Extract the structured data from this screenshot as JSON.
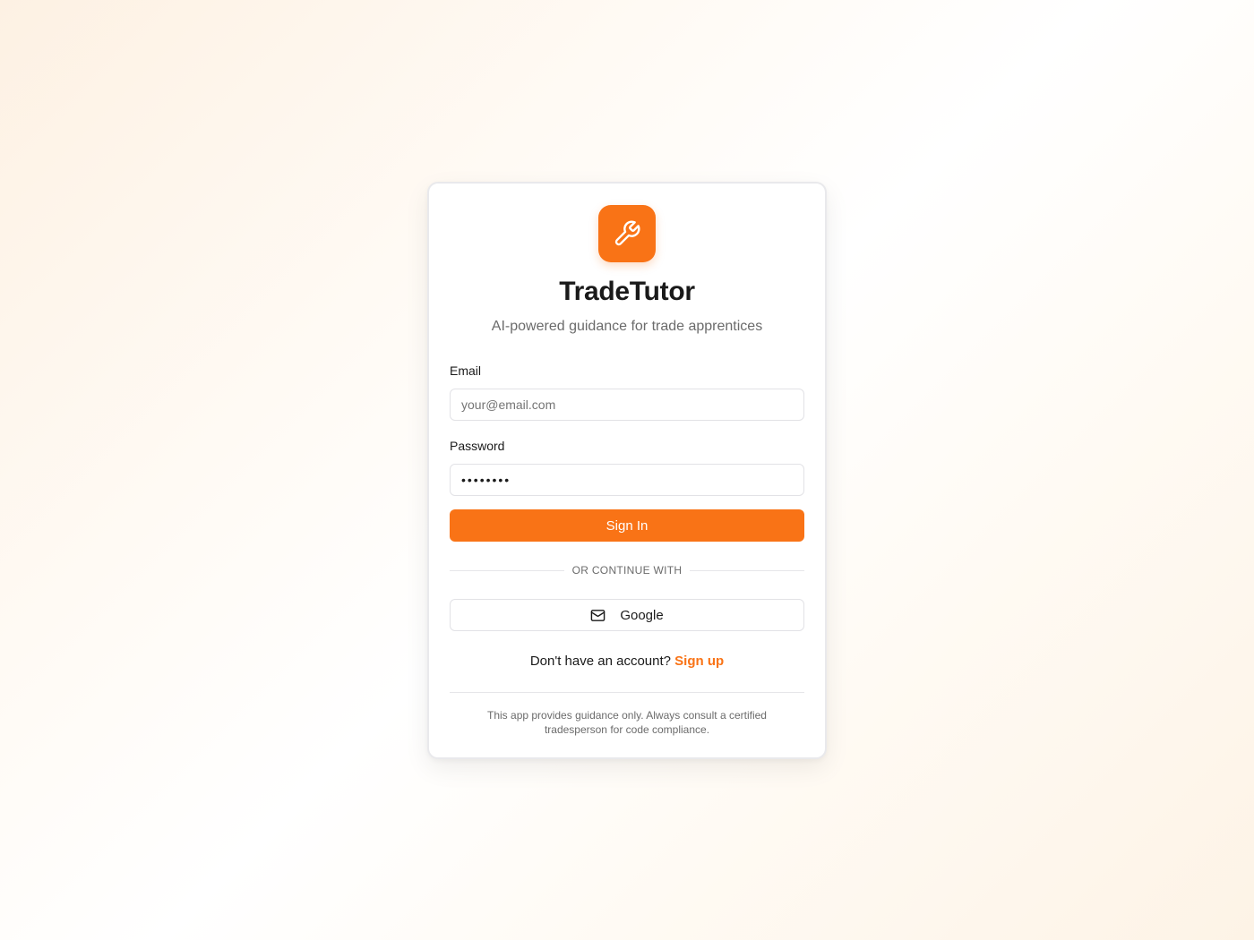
{
  "app": {
    "title": "TradeTutor",
    "subtitle": "AI-powered guidance for trade apprentices",
    "logo_icon": "wrench-icon",
    "accent_color": "#f97316"
  },
  "form": {
    "email_label": "Email",
    "email_placeholder": "your@email.com",
    "email_value": "",
    "password_label": "Password",
    "password_value": "••••••••",
    "sign_in_label": "Sign In"
  },
  "alt_login": {
    "divider_text": "OR CONTINUE WITH",
    "google_label": "Google",
    "google_icon": "mail-icon"
  },
  "signup": {
    "prompt": "Don't have an account? ",
    "link_label": "Sign up"
  },
  "footer": {
    "disclaimer": "This app provides guidance only. Always consult a certified tradesperson for code compliance."
  }
}
